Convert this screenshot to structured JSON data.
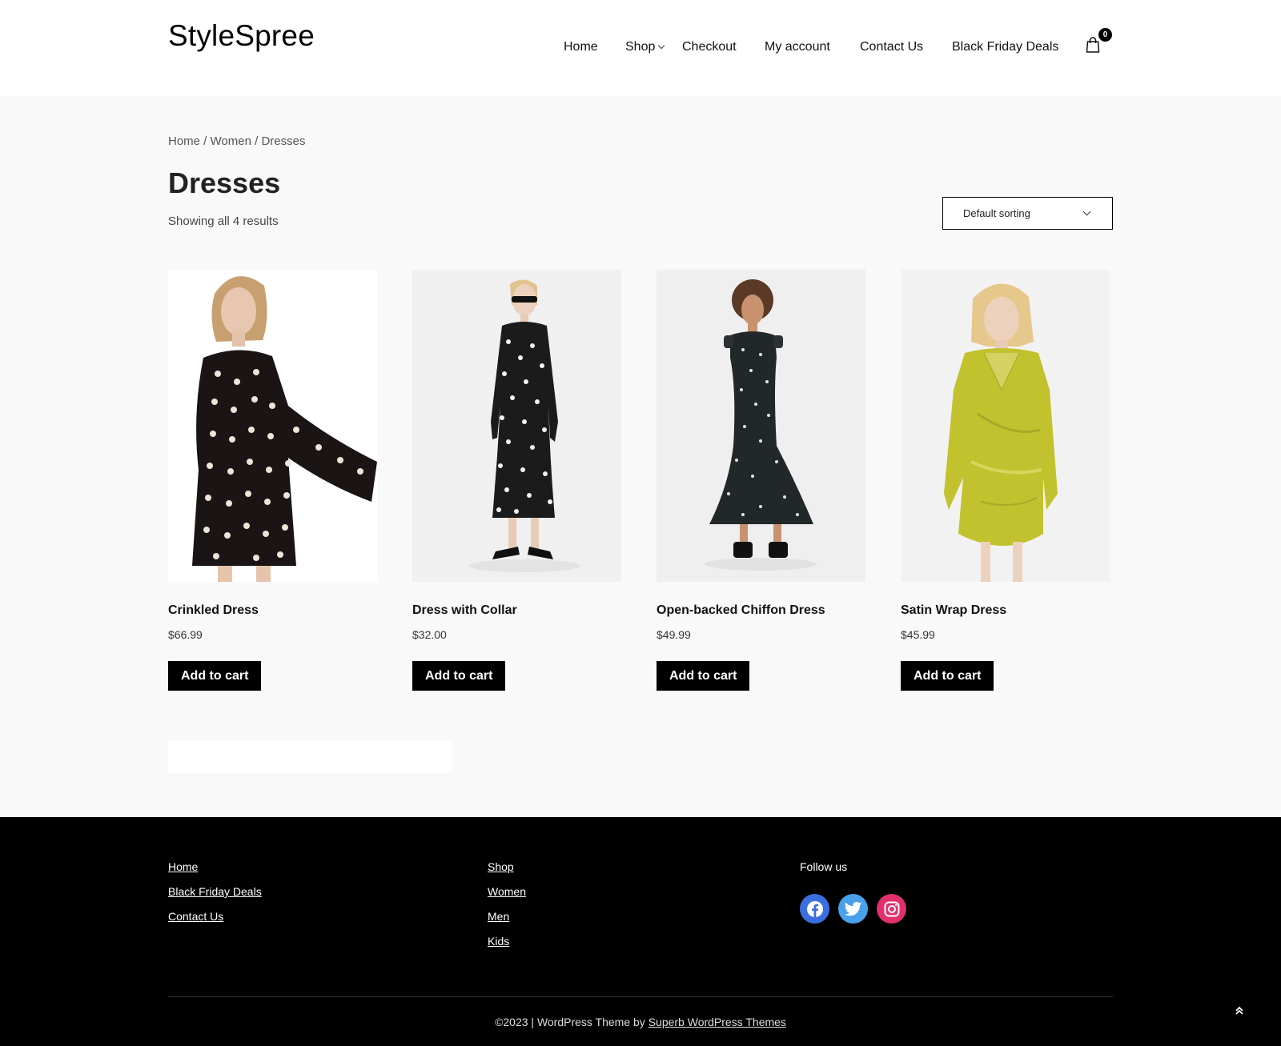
{
  "header": {
    "logo": "StyleSpree",
    "nav": [
      {
        "label": "Home"
      },
      {
        "label": "Shop",
        "has_dropdown": true
      },
      {
        "label": "Checkout"
      },
      {
        "label": "My account"
      },
      {
        "label": "Contact Us"
      },
      {
        "label": "Black Friday Deals"
      }
    ],
    "cart_count": "0",
    "cart_icon": "shopping-bag-icon"
  },
  "breadcrumb": {
    "items": [
      "Home",
      "Women",
      "Dresses"
    ],
    "separator": " / "
  },
  "page": {
    "title": "Dresses",
    "result_count": "Showing all 4 results"
  },
  "sorting": {
    "selected": "Default sorting"
  },
  "products": [
    {
      "name": "Crinkled Dress",
      "price": "$66.99",
      "button": "Add to cart",
      "dress_color": "#1a1414",
      "pattern": "polka-dots"
    },
    {
      "name": "Dress with Collar",
      "price": "$32.00",
      "button": "Add to cart",
      "dress_color": "#1b1b1b",
      "pattern": "floral"
    },
    {
      "name": "Open-backed Chiffon Dress",
      "price": "$49.99",
      "button": "Add to cart",
      "dress_color": "#22282a",
      "pattern": "dots-small"
    },
    {
      "name": "Satin Wrap Dress",
      "price": "$45.99",
      "button": "Add to cart",
      "dress_color": "#c2c22f",
      "pattern": "satin"
    }
  ],
  "footer": {
    "col1": [
      "Home",
      "Black Friday Deals",
      "Contact Us"
    ],
    "col2": [
      "Shop",
      "Women",
      "Men",
      "Kids"
    ],
    "follow_label": "Follow us",
    "social": [
      {
        "icon": "facebook-icon",
        "color": "#3b6fe0"
      },
      {
        "icon": "twitter-icon",
        "color": "#4aa1eb"
      },
      {
        "icon": "instagram-icon",
        "color": "#e1306c"
      }
    ],
    "copyright_prefix": "©2023 | WordPress Theme by ",
    "copyright_link": "Superb WordPress Themes",
    "back_to_top_icon": "double-chevron-up-icon"
  },
  "colors": {
    "accent": "#000000",
    "page_bg": "#f9f9f9",
    "footer_bg": "#000000"
  }
}
